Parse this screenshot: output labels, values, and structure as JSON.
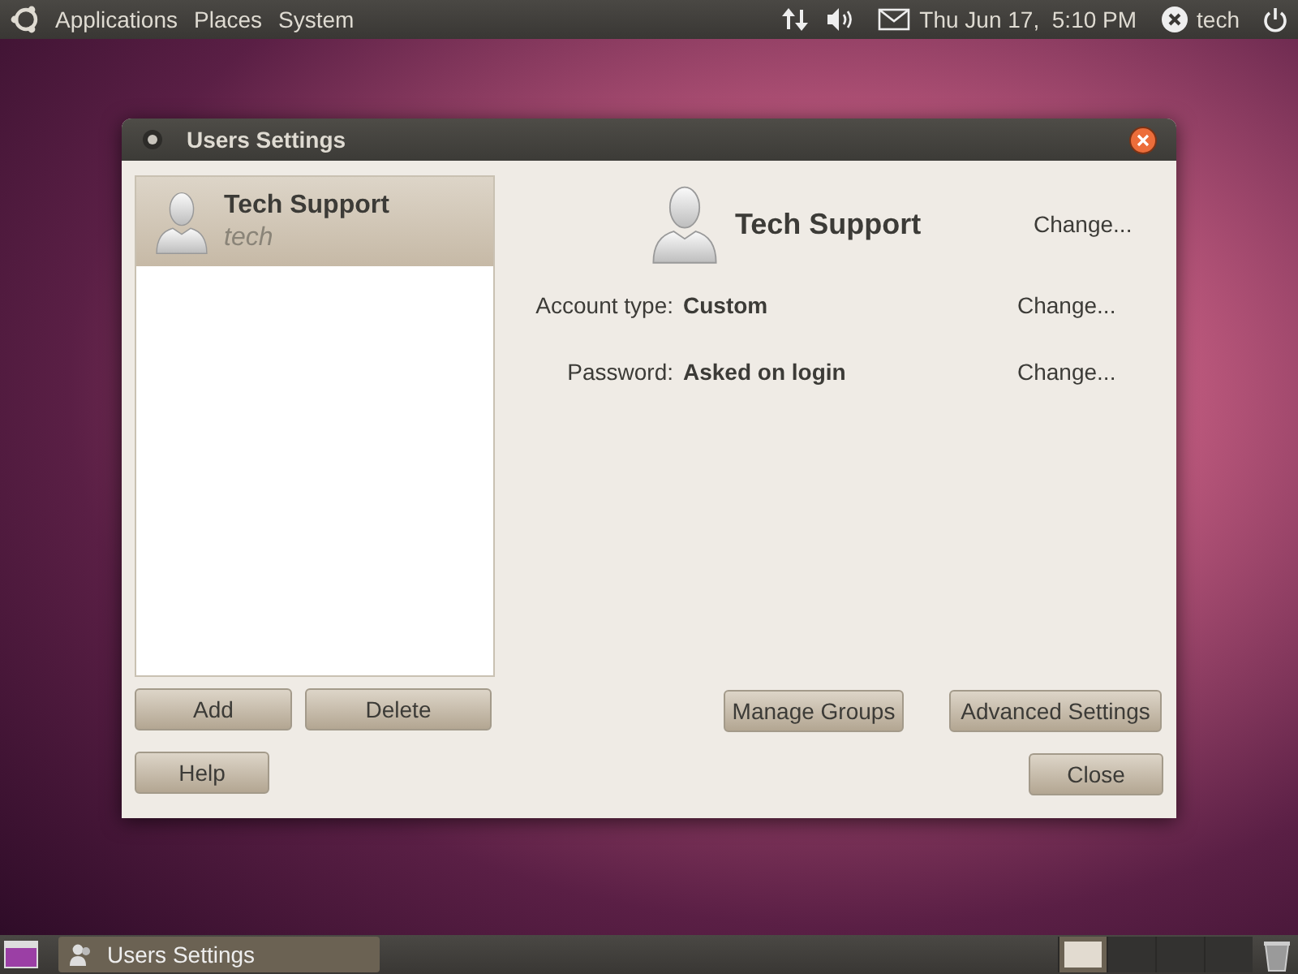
{
  "top_panel": {
    "menus": [
      "Applications",
      "Places",
      "System"
    ],
    "clock": "Thu Jun 17,  5:10 PM",
    "user": "tech"
  },
  "window": {
    "title": "Users Settings",
    "users": [
      {
        "name": "Tech Support",
        "login": "tech",
        "selected": true
      }
    ],
    "header": {
      "name": "Tech Support",
      "change": "Change..."
    },
    "fields": [
      {
        "label": "Account type:",
        "value": "Custom",
        "change": "Change..."
      },
      {
        "label": "Password:",
        "value": "Asked on login",
        "change": "Change..."
      }
    ],
    "list_buttons": [
      "Add",
      "Delete"
    ],
    "action_buttons": [
      "Manage Groups",
      "Advanced Settings"
    ],
    "help": "Help",
    "close": "Close"
  },
  "bottom_panel": {
    "tasks": [
      {
        "label": "Users Settings",
        "selected": false
      }
    ],
    "workspaces": [
      {
        "selected": true
      },
      {
        "selected": false
      },
      {
        "selected": false
      },
      {
        "selected": false
      }
    ]
  }
}
